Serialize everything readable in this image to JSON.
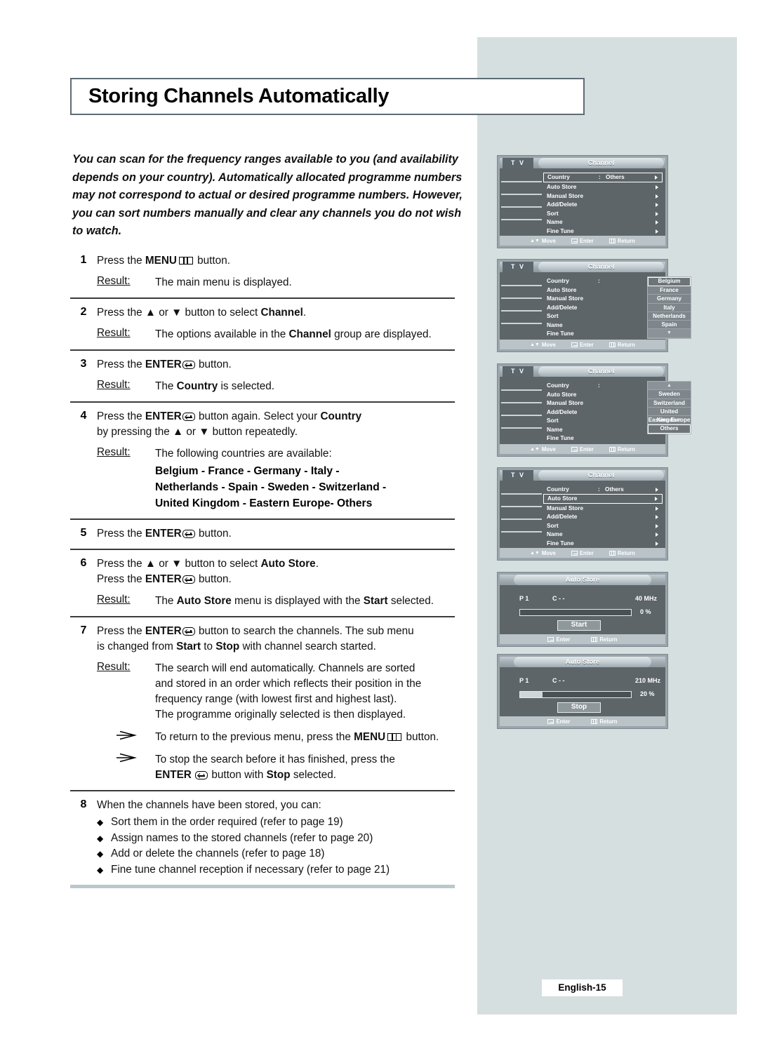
{
  "page": {
    "title": "Storing Channels Automatically",
    "footer": "English-15"
  },
  "intro": "You can scan for the frequency ranges available to you (and availability depends on your country). Automatically allocated programme numbers may not correspond to actual or desired programme numbers. However, you can sort numbers manually and clear any channels you do not wish to watch.",
  "labels": {
    "result": "Result:",
    "press_the": "Press the",
    "button": "button.",
    "or": "or"
  },
  "steps": [
    {
      "num": "1",
      "line_pre": "Press the",
      "bold1": "MENU",
      "icon1": "menu-icon",
      "line_post": "button.",
      "result_label": "Result:",
      "result": "The main menu is displayed."
    },
    {
      "num": "2",
      "line_a": "Press the ▲ or ▼ button to select ",
      "bold_a": "Channel",
      "line_a_end": ".",
      "result_label": "Result:",
      "result_pre": "The options available in the ",
      "result_bold": "Channel",
      "result_post": " group are displayed."
    },
    {
      "num": "3",
      "line_pre": "Press the",
      "bold1": "ENTER",
      "icon1": "enter-icon",
      "line_post": "button.",
      "result_label": "Result:",
      "result_pre": "The ",
      "result_bold": "Country",
      "result_post": " is selected."
    },
    {
      "num": "4",
      "line_pre": "Press the",
      "bold1": "ENTER",
      "icon1": "enter-icon",
      "line_mid": "button again. Select your ",
      "bold2": "Country",
      "line2": "by pressing the ▲ or ▼ button repeatedly.",
      "result_label": "Result:",
      "result": "The following countries are available:",
      "countries": [
        "Belgium - France - Germany -  Italy -",
        "Netherlands - Spain - Sweden - Switzerland -",
        "United Kingdom - Eastern Europe- Others"
      ]
    },
    {
      "num": "5",
      "line_pre": "Press the",
      "bold1": "ENTER",
      "icon1": "enter-icon",
      "line_post": "button."
    },
    {
      "num": "6",
      "line_a_pre": "Press the ▲ or ▼ button to select ",
      "bold_a": "Auto Store",
      "line_a_end": ".",
      "line_b_pre": "Press the",
      "bold_b": "ENTER",
      "line_b_post": "button.",
      "result_label": "Result:",
      "result_pre": "The ",
      "result_bold1": "Auto Store",
      "result_mid": " menu is displayed with the ",
      "result_bold2": "Start",
      "result_post": " selected."
    },
    {
      "num": "7",
      "line_a_pre": "Press the",
      "bold_a": "ENTER",
      "line_a_post": "button to search the channels. The sub menu",
      "line_b_pre": "is changed from ",
      "bold_b1": "Start",
      "line_b_mid": " to ",
      "bold_b2": "Stop",
      "line_b_post": " with channel search started.",
      "result_label": "Result:",
      "result_lines": [
        "The search will end automatically. Channels are sorted",
        "and stored in an order which reflects their position in the",
        "frequency range (with lowest first and highest last).",
        "The programme originally selected is then displayed."
      ],
      "notes": [
        {
          "pre": "To return to the previous menu, press the ",
          "bold": "MENU",
          "icon": "menu-icon",
          "post": "button."
        },
        {
          "pre": "To stop the search before it has finished, press the",
          "bold": "ENTER",
          "icon": "enter-icon",
          "mid": "button with ",
          "bold2": "Stop",
          "post": " selected."
        }
      ]
    },
    {
      "num": "8",
      "line": "When the channels have been stored, you can:",
      "bullets": [
        "Sort them in the order required (refer to page 19)",
        "Assign names to the stored channels (refer to page 20)",
        "Add or delete the channels (refer to page 18)",
        "Fine tune channel reception if necessary (refer to page 21)"
      ]
    }
  ],
  "osd": {
    "tv_label": "T V",
    "channel_title": "Channel",
    "auto_store_title": "Auto Store",
    "footer": {
      "move": "Move",
      "enter": "Enter",
      "return": "Return"
    },
    "menu_items": [
      "Country",
      "Auto Store",
      "Manual Store",
      "Add/Delete",
      "Sort",
      "Name",
      "Fine Tune"
    ],
    "panels": [
      {
        "id": "panel-country-others",
        "title": "Channel",
        "country_value": "Others",
        "selected_row": 0,
        "show_carets": true,
        "dropdown": null
      },
      {
        "id": "panel-country-list-1",
        "title": "Channel",
        "country_value": "",
        "selected_row": -1,
        "show_carets": false,
        "dropdown": {
          "items": [
            "Belgium",
            "France",
            "Germany",
            "Italy",
            "Netherlands",
            "Spain"
          ],
          "highlight": 0,
          "nav_top": null,
          "nav_bottom": "▼"
        }
      },
      {
        "id": "panel-country-list-2",
        "title": "Channel",
        "country_value": "",
        "selected_row": -1,
        "show_carets": false,
        "dropdown": {
          "items": [
            "Sweden",
            "Switzerland",
            "United Kingdom",
            "Eastern Europe",
            "Others"
          ],
          "highlight": 4,
          "nav_top": "▲",
          "nav_bottom": null
        }
      },
      {
        "id": "panel-auto-store-selected",
        "title": "Channel",
        "country_value": "Others",
        "selected_row": 1,
        "show_carets": true,
        "dropdown": null
      }
    ],
    "auto_store_panels": [
      {
        "id": "auto-store-start",
        "title": "Auto Store",
        "p_label": "P  1",
        "c_label": "C  - -",
        "freq": "40  MHz",
        "percent": "0  %",
        "progress": 0,
        "button": "Start"
      },
      {
        "id": "auto-store-stop",
        "title": "Auto Store",
        "p_label": "P  1",
        "c_label": "C  - -",
        "freq": "210  MHz",
        "percent": "20  %",
        "progress": 20,
        "button": "Stop"
      }
    ]
  },
  "colors": {
    "sidebar": "#d6dfdf",
    "title_border": "#5d6b74",
    "osd_body": "#5e6569",
    "osd_frame": "#9aa5ab",
    "osd_footer": "#b9c3c8"
  }
}
